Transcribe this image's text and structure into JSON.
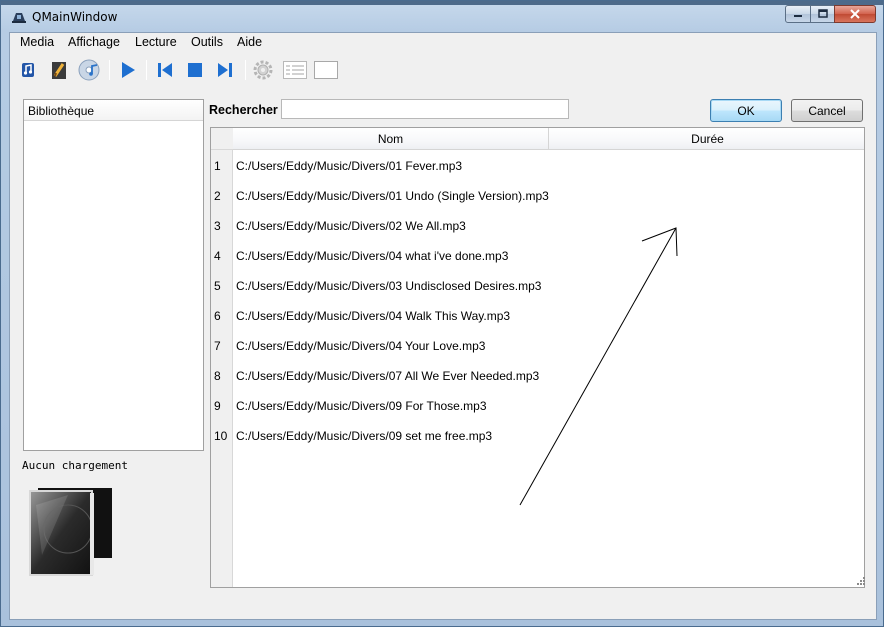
{
  "window": {
    "title": "QMainWindow",
    "minimize_glyph": "–",
    "maximize_glyph": "□",
    "close_glyph": "✕"
  },
  "menubar": {
    "items": [
      {
        "label": "Media"
      },
      {
        "label": "Affichage"
      },
      {
        "label": "Lecture"
      },
      {
        "label": "Outils"
      },
      {
        "label": "Aide"
      }
    ]
  },
  "toolbar": {
    "icons": [
      "music-note-icon",
      "pen-note-icon",
      "disc-music-icon",
      "play-icon",
      "previous-icon",
      "stop-icon",
      "next-icon",
      "settings-gear-icon",
      "list-view-icon",
      "blank-view-icon"
    ]
  },
  "library": {
    "header": "Bibliothèque",
    "status": "Aucun chargement"
  },
  "search": {
    "label": "Rechercher",
    "value": "",
    "placeholder": ""
  },
  "buttons": {
    "ok": "OK",
    "cancel": "Cancel"
  },
  "table": {
    "columns": [
      "Nom",
      "Durée"
    ],
    "rows": [
      {
        "num": "1",
        "name": "C:/Users/Eddy/Music/Divers/01 Fever.mp3",
        "duration": ""
      },
      {
        "num": "2",
        "name": "C:/Users/Eddy/Music/Divers/01 Undo (Single Version).mp3",
        "duration": ""
      },
      {
        "num": "3",
        "name": "C:/Users/Eddy/Music/Divers/02 We All.mp3",
        "duration": ""
      },
      {
        "num": "4",
        "name": "C:/Users/Eddy/Music/Divers/04 what i've done.mp3",
        "duration": ""
      },
      {
        "num": "5",
        "name": "C:/Users/Eddy/Music/Divers/03 Undisclosed Desires.mp3",
        "duration": ""
      },
      {
        "num": "6",
        "name": "C:/Users/Eddy/Music/Divers/04 Walk This Way.mp3",
        "duration": ""
      },
      {
        "num": "7",
        "name": "C:/Users/Eddy/Music/Divers/04 Your Love.mp3",
        "duration": ""
      },
      {
        "num": "8",
        "name": "C:/Users/Eddy/Music/Divers/07 All We Ever Needed.mp3",
        "duration": ""
      },
      {
        "num": "9",
        "name": "C:/Users/Eddy/Music/Divers/09 For Those.mp3",
        "duration": ""
      },
      {
        "num": "10",
        "name": "C:/Users/Eddy/Music/Divers/09 set me free.mp3",
        "duration": ""
      }
    ]
  },
  "colors": {
    "accent_blue": "#1e6fd0",
    "frame_blue": "#b6cce4",
    "client_bg": "#f0f0f0"
  }
}
